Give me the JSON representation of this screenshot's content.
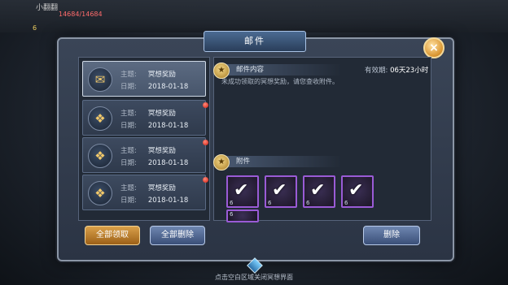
{
  "hud": {
    "player_name": "小翻翻",
    "player_sub": "14684/14684",
    "power": "6"
  },
  "dialog": {
    "title": "邮件",
    "close_label": "×"
  },
  "mail_list": [
    {
      "subject_label": "主题:",
      "subject": "冥想奖励",
      "date_label": "日期:",
      "date": "2018-01-18",
      "selected": true,
      "unread": false
    },
    {
      "subject_label": "主题:",
      "subject": "冥想奖励",
      "date_label": "日期:",
      "date": "2018-01-18",
      "selected": false,
      "unread": true
    },
    {
      "subject_label": "主题:",
      "subject": "冥想奖励",
      "date_label": "日期:",
      "date": "2018-01-18",
      "selected": false,
      "unread": true
    },
    {
      "subject_label": "主题:",
      "subject": "冥想奖励",
      "date_label": "日期:",
      "date": "2018-01-18",
      "selected": false,
      "unread": true
    }
  ],
  "content": {
    "section_title": "邮件内容",
    "expiry_label": "有效期:",
    "expiry_value": "06天23小时",
    "body": "未成功领取的冥想奖励，请您查收附件。"
  },
  "attachments": {
    "section_title": "附件",
    "items": [
      {
        "qty": "6"
      },
      {
        "qty": "6"
      },
      {
        "qty": "6"
      },
      {
        "qty": "6"
      },
      {
        "qty": "6"
      }
    ]
  },
  "buttons": {
    "claim_all": "全部领取",
    "delete_all": "全部删除",
    "delete": "删除"
  },
  "footer_hint": "点击空白区域关闭冥想界面",
  "colors": {
    "attachment_border": "#9a5bd6",
    "unread_dot": "#d11b0e",
    "gold_button": "#d9a04a",
    "blue_button": "#6e86b0"
  }
}
